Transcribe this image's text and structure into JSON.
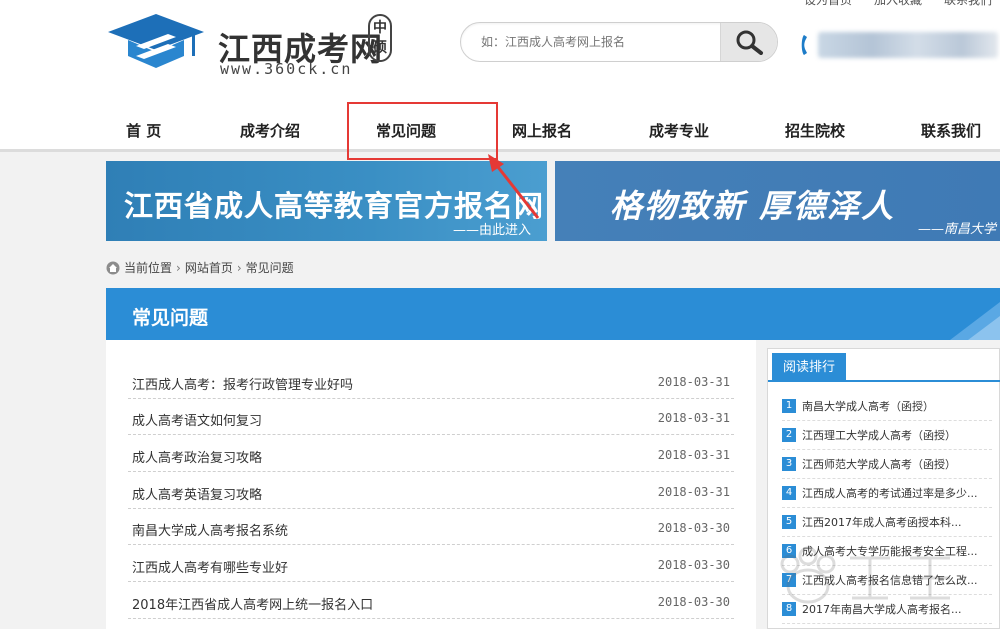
{
  "top_links": [
    "设为首页",
    "加入收藏",
    "联系我们"
  ],
  "logo": {
    "title": "江西成考网",
    "badge": "中硕",
    "url": "www.360ck.cn"
  },
  "search": {
    "placeholder": "如：江西成人高考网上报名"
  },
  "nav": {
    "items": [
      "首 页",
      "成考介绍",
      "常见问题",
      "网上报名",
      "成考专业",
      "招生院校",
      "联系我们"
    ]
  },
  "banners": {
    "left_title": "江西省成人高等教育官方报名网",
    "left_sub": "——由此进入",
    "right_title": "格物致新  厚德泽人",
    "right_sub": "——南昌大学"
  },
  "breadcrumb": {
    "current_label": "当前位置",
    "items": [
      "网站首页",
      "常见问题"
    ]
  },
  "section": {
    "title": "常见问题"
  },
  "articles": [
    {
      "title": "江西成人高考：报考行政管理专业好吗",
      "date": "2018-03-31"
    },
    {
      "title": "成人高考语文如何复习",
      "date": "2018-03-31"
    },
    {
      "title": "成人高考政治复习攻略",
      "date": "2018-03-31"
    },
    {
      "title": "成人高考英语复习攻略",
      "date": "2018-03-31"
    },
    {
      "title": "南昌大学成人高考报名系统",
      "date": "2018-03-30"
    },
    {
      "title": "江西成人高考有哪些专业好",
      "date": "2018-03-30"
    },
    {
      "title": "2018年江西省成人高考网上统一报名入口",
      "date": "2018-03-30"
    }
  ],
  "sidebar": {
    "tab": "阅读排行",
    "items": [
      {
        "num": "1",
        "text": "南昌大学成人高考（函授）"
      },
      {
        "num": "2",
        "text": "江西理工大学成人高考（函授）"
      },
      {
        "num": "3",
        "text": "江西师范大学成人高考（函授）"
      },
      {
        "num": "4",
        "text": "江西成人高考的考试通过率是多少..."
      },
      {
        "num": "5",
        "text": "江西2017年成人高考函授本科..."
      },
      {
        "num": "6",
        "text": "成人高考大专学历能报考安全工程..."
      },
      {
        "num": "7",
        "text": "江西成人高考报名信息错了怎么改..."
      },
      {
        "num": "8",
        "text": "2017年南昌大学成人高考报名..."
      }
    ]
  },
  "colors": {
    "primary_blue": "#2b8dd6",
    "annotation_red": "#e53935"
  }
}
